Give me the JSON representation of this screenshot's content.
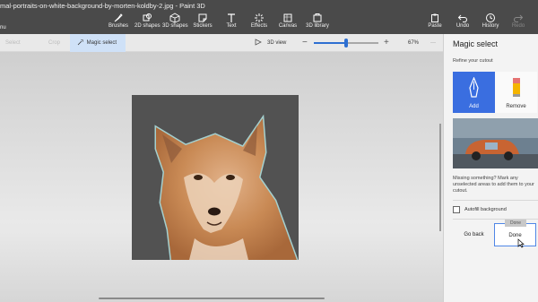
{
  "window": {
    "title": "mal-portraits-on-white-background-by-morten-koldby-2.jpg - Paint 3D",
    "menu_label": "nu"
  },
  "toolbar": {
    "tools": [
      {
        "label": "Brushes",
        "icon": "brush-icon"
      },
      {
        "label": "2D shapes",
        "icon": "2d-shapes-icon"
      },
      {
        "label": "3D shapes",
        "icon": "3d-shapes-icon"
      },
      {
        "label": "Stickers",
        "icon": "stickers-icon"
      },
      {
        "label": "Text",
        "icon": "text-icon"
      },
      {
        "label": "Effects",
        "icon": "effects-icon"
      },
      {
        "label": "Canvas",
        "icon": "canvas-icon"
      },
      {
        "label": "3D library",
        "icon": "3d-library-icon"
      }
    ],
    "actions": [
      {
        "label": "Paste",
        "icon": "paste-icon"
      },
      {
        "label": "Undo",
        "icon": "undo-icon"
      },
      {
        "label": "History",
        "icon": "history-icon"
      },
      {
        "label": "Redo",
        "icon": "redo-icon"
      }
    ]
  },
  "subbar": {
    "select_label": "Select",
    "crop_label": "Crop",
    "magic_select_label": "Magic select",
    "view_3d_label": "3D view",
    "zoom_minus": "−",
    "zoom_plus": "+",
    "zoom_value": "67%",
    "zoom_fraction": 0.5,
    "more": "···"
  },
  "panel": {
    "title": "Magic select",
    "subtitle": "Refine your cutout",
    "add_label": "Add",
    "remove_label": "Remove",
    "hint": "Missing something? Mark any unselected areas to add them to your cutout.",
    "autofill_label": "Autofill background",
    "go_back_label": "Go back",
    "done_label": "Done",
    "done_tooltip": "Done"
  },
  "colors": {
    "accent": "#3a6ee0",
    "toolbar_bg": "#4a4a4a",
    "image_bg": "#525252"
  }
}
